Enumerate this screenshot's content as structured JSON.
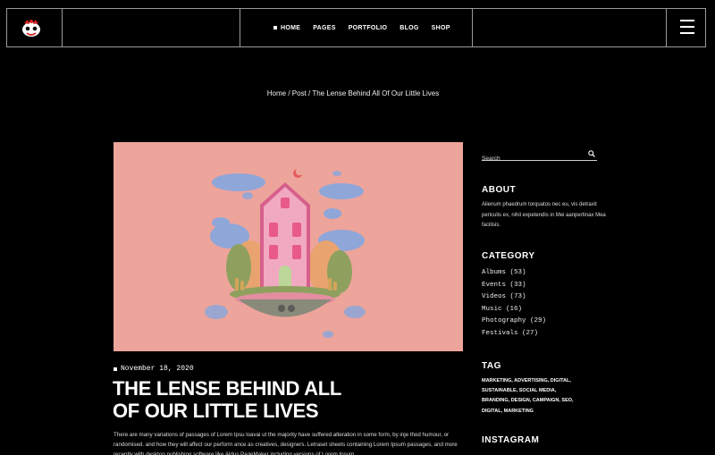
{
  "header": {
    "nav": [
      {
        "label": "HOME",
        "active": true
      },
      {
        "label": "PAGES"
      },
      {
        "label": "PORTFOLIO"
      },
      {
        "label": "BLOG"
      },
      {
        "label": "SHOP"
      }
    ]
  },
  "breadcrumb": {
    "home": "Home",
    "sep1": " / ",
    "post": "Post",
    "sep2": " / ",
    "current": "The Lense Behind All Of Our Little Lives"
  },
  "post": {
    "date": "November 18, 2020",
    "title_line1": "THE LENSE BEHIND ALL",
    "title_line2": "OF OUR LITTLE LIVES",
    "body": "There are many variations of passages of Lorem Ipsu loavai ut the majority have suffered alteration in some form, by inje thod humour, or randomised. and how they will affect our perform ance as creatives, designers. Letraset sheets containing Lorem Ipsum passages, and more recently with desktop publishing software like Aldus PageMaker including versions of Lorem Ipsum."
  },
  "sidebar": {
    "search_placeholder": "Search",
    "about_heading": "ABOUT",
    "about_text": "Alienum phaedrum torquatos nec eu, vis detraxit periculis ex, nihil expetendis in Mei aanpertinax Mea facilisis.",
    "category_heading": "CATEGORY",
    "categories": [
      "Albums (53)",
      "Events  (33)",
      "Videos (73)",
      "Music  (16)",
      "Photography (29)",
      "Festivals (27)"
    ],
    "tag_heading": "TAG",
    "tags": "MARKETING, ADVERTISING, DIGITAL, SUSTAINABLE, SOCIAL MEDIA, BRANDING, DESIGN, CAMPAIGN, SEO, DIGITAL, MARKETING",
    "instagram_heading": "INSTAGRAM"
  },
  "icons": {
    "logo": "mascot-logo-icon",
    "menu": "hamburger-menu-icon",
    "search": "search-icon"
  },
  "colors": {
    "background": "#000000",
    "hero_bg": "#eda49b",
    "border": "#9a9a9a"
  }
}
